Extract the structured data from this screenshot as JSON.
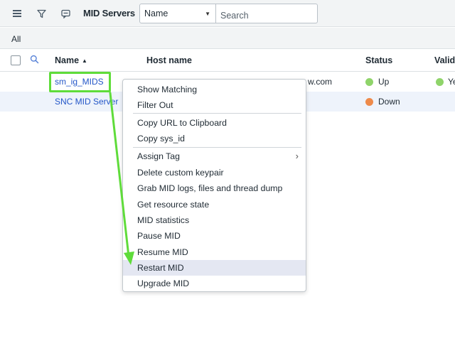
{
  "toolbar": {
    "title": "MID Servers",
    "field_select_value": "Name",
    "search_placeholder": "Search"
  },
  "breadcrumb": "All",
  "columns": {
    "name": "Name",
    "host_name": "Host name",
    "status": "Status",
    "validated": "Valid"
  },
  "rows": [
    {
      "name": "sm_ig_MIDS",
      "host_name": "w.com",
      "status": "Up",
      "status_color": "#8fd46a",
      "validated": "Ye",
      "validated_color": "#8fd46a"
    },
    {
      "name": "SNC MID Server",
      "host_name": "",
      "status": "Down",
      "status_color": "#ee8a4a"
    }
  ],
  "context_menu": {
    "items": [
      {
        "label": "Show Matching"
      },
      {
        "label": "Filter Out"
      },
      {
        "label": "Copy URL to Clipboard"
      },
      {
        "label": "Copy sys_id"
      },
      {
        "label": "Assign Tag",
        "has_submenu": true
      },
      {
        "label": "Delete custom keypair"
      },
      {
        "label": "Grab MID logs, files and thread dump"
      },
      {
        "label": "Get resource state"
      },
      {
        "label": "MID statistics"
      },
      {
        "label": "Pause MID"
      },
      {
        "label": "Resume MID"
      },
      {
        "label": "Restart MID",
        "selected": true
      },
      {
        "label": "Upgrade MID"
      }
    ]
  },
  "annotation_color": "#5fdc3a",
  "link_color": "#2356c8"
}
